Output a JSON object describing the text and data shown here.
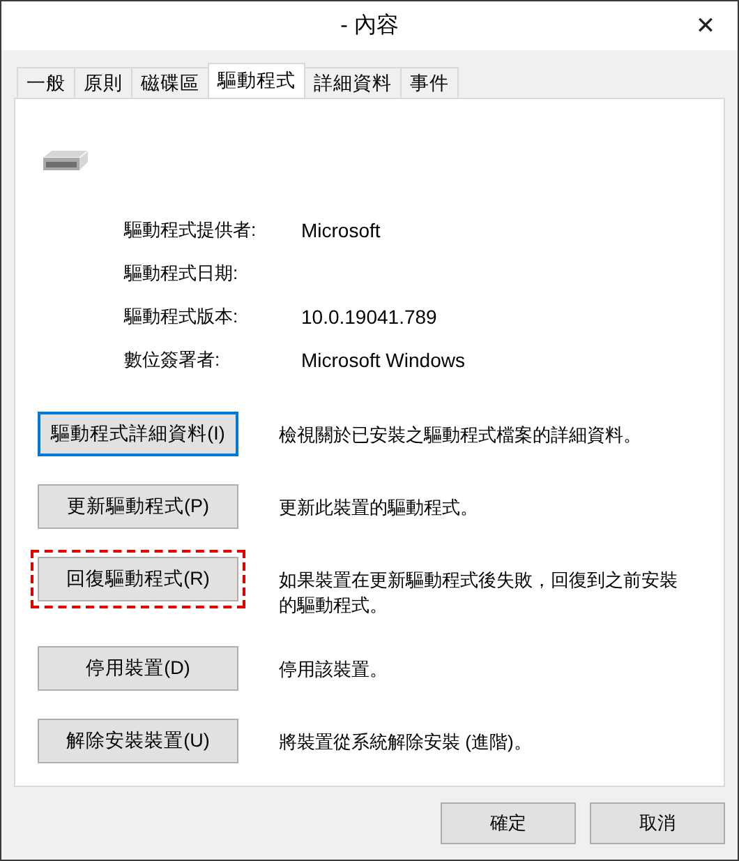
{
  "window": {
    "title": "- 內容",
    "close": "✕"
  },
  "tabs": [
    {
      "label": "一般",
      "selected": false
    },
    {
      "label": "原則",
      "selected": false
    },
    {
      "label": "磁碟區",
      "selected": false
    },
    {
      "label": "驅動程式",
      "selected": true
    },
    {
      "label": "詳細資料",
      "selected": false
    },
    {
      "label": "事件",
      "selected": false
    }
  ],
  "driver_info": [
    {
      "label": "驅動程式提供者:",
      "value": "Microsoft"
    },
    {
      "label": "驅動程式日期:"
    },
    {
      "label": "驅動程式版本:",
      "value": "10.0.19041.789"
    },
    {
      "label": "數位簽署者:",
      "value": "Microsoft Windows"
    }
  ],
  "actions": [
    {
      "button": "驅動程式詳細資料(I)",
      "description": "檢視關於已安裝之驅動程式檔案的詳細資料。",
      "focused": true,
      "highlighted": false
    },
    {
      "button": "更新驅動程式(P)",
      "description": "更新此裝置的驅動程式。",
      "focused": false,
      "highlighted": false
    },
    {
      "button": "回復驅動程式(R)",
      "description": "如果裝置在更新驅動程式後失敗，回復到之前安裝的驅動程式。",
      "focused": false,
      "highlighted": true
    },
    {
      "button": "停用裝置(D)",
      "description": "停用該裝置。",
      "focused": false,
      "highlighted": false
    },
    {
      "button": "解除安裝裝置(U)",
      "description": "將裝置從系統解除安裝 (進階)。",
      "focused": false,
      "highlighted": false
    }
  ],
  "buttons": [
    "確定",
    "取消"
  ]
}
